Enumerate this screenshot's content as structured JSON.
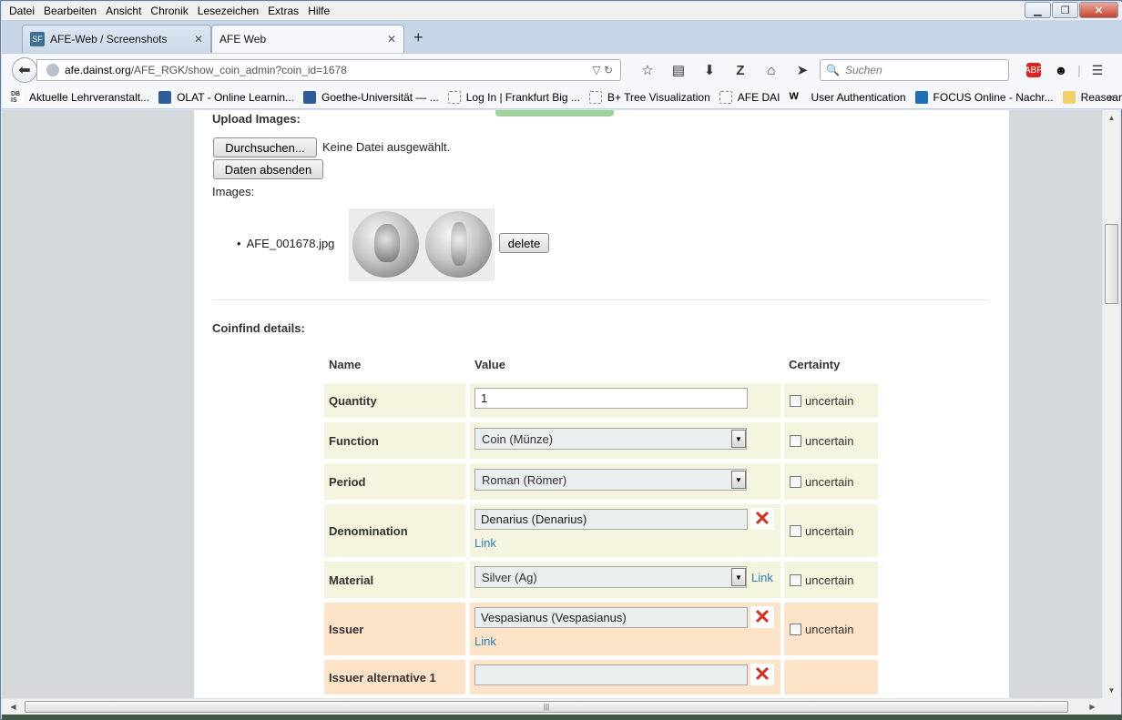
{
  "menubar": {
    "items": [
      "Datei",
      "Bearbeiten",
      "Ansicht",
      "Chronik",
      "Lesezeichen",
      "Extras",
      "Hilfe"
    ]
  },
  "tabs": [
    {
      "icon": "SF",
      "label": "AFE-Web / Screenshots"
    },
    {
      "label": "AFE Web"
    }
  ],
  "navbar": {
    "url_host": "afe.dainst.org",
    "url_path": "/AFE_RGK/show_coin_admin?coin_id=1678",
    "search_placeholder": "Suchen"
  },
  "bookmarks": [
    {
      "label": "Aktuelle Lehrveranstalt...",
      "icon": "dbis"
    },
    {
      "label": "OLAT - Online Learnin...",
      "icon": "blue"
    },
    {
      "label": "Goethe-Universität — ...",
      "icon": "blue"
    },
    {
      "label": "Log In | Frankfurt Big ...",
      "icon": "blank"
    },
    {
      "label": "B+ Tree Visualization",
      "icon": "blank"
    },
    {
      "label": "AFE DAI",
      "icon": "blank"
    },
    {
      "label": "User Authentication",
      "icon": "w"
    },
    {
      "label": "FOCUS Online - Nachr...",
      "icon": "focus"
    },
    {
      "label": "Reasearch",
      "icon": "folder"
    }
  ],
  "upload": {
    "heading": "Upload Images:",
    "browse_label": "Durchsuchen...",
    "file_status": "Keine Datei ausgewählt.",
    "submit_label": "Daten absenden",
    "images_label": "Images:",
    "image_file": "AFE_001678.jpg",
    "delete_label": "delete"
  },
  "coinfind": {
    "heading": "Coinfind details:",
    "headers": {
      "name": "Name",
      "value": "Value",
      "certainty": "Certainty"
    },
    "uncertain_label": "uncertain",
    "link_label": "Link",
    "rows": [
      {
        "name": "Quantity",
        "value": "1"
      },
      {
        "name": "Function",
        "value": "Coin (Münze)"
      },
      {
        "name": "Period",
        "value": "Roman (Römer)"
      },
      {
        "name": "Denomination",
        "value": "Denarius (Denarius)"
      },
      {
        "name": "Material",
        "value": "Silver (Ag)"
      },
      {
        "name": "Issuer",
        "value": "Vespasianus (Vespasianus)"
      },
      {
        "name": "Issuer alternative 1",
        "value": ""
      }
    ]
  },
  "colors": {
    "row_bg_default": "#f4f4df",
    "row_bg_highlight": "#fde3c8",
    "link": "#2f7fc1",
    "remove_icon": "#d6301c"
  }
}
